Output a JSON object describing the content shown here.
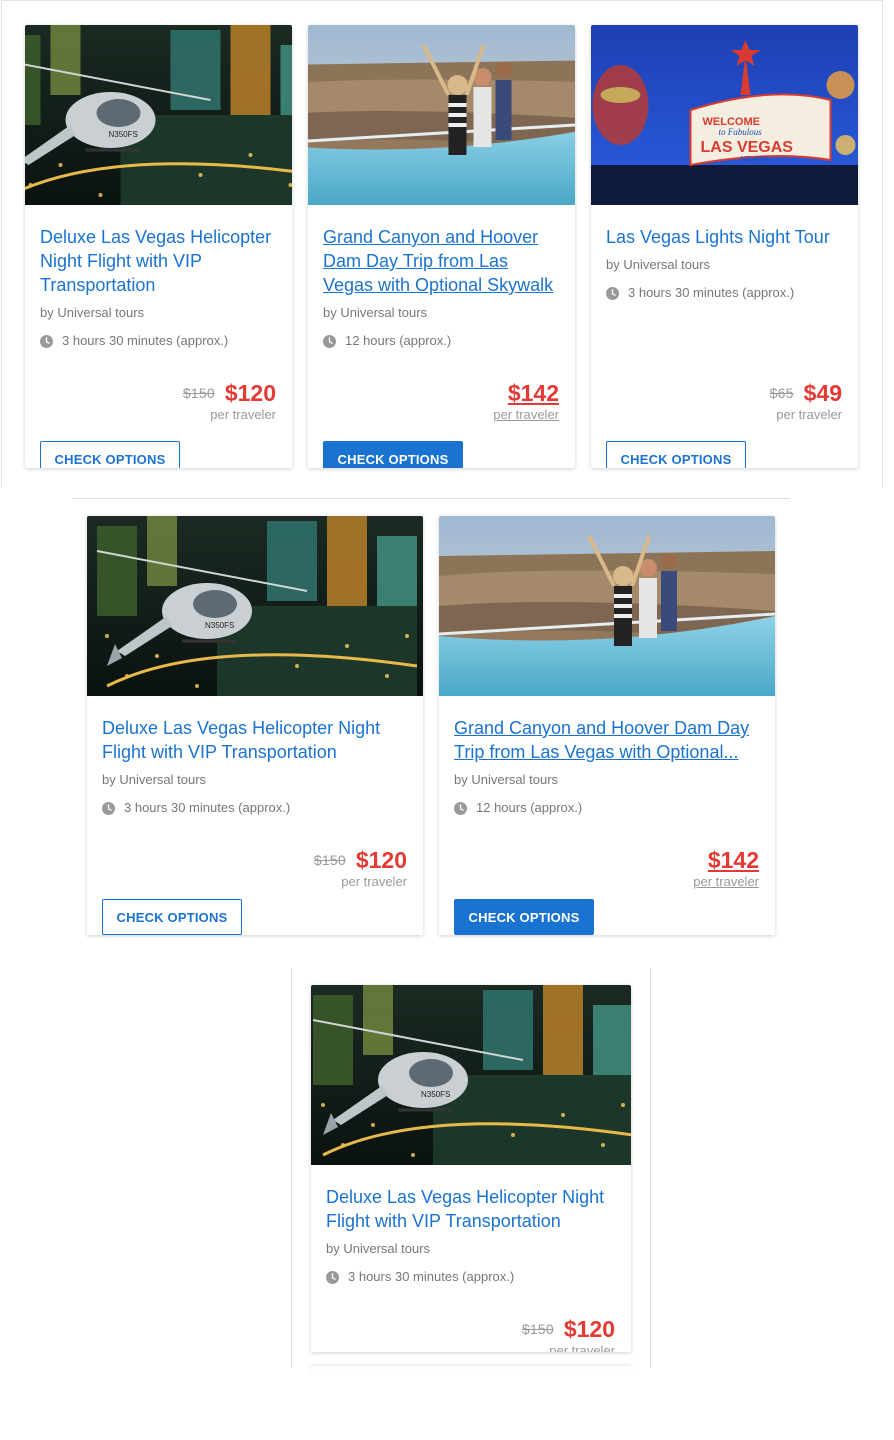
{
  "colors": {
    "accent": "#1a73d0",
    "price": "#e53935",
    "muted": "#777777"
  },
  "common": {
    "per_traveler": "per traveler",
    "check_options": "CHECK OPTIONS",
    "clock_icon": "clock-icon"
  },
  "section1": {
    "cards": [
      {
        "title": "Deluxe Las Vegas Helicopter Night Flight with VIP Transportation",
        "vendor": "by Universal tours",
        "duration": "3 hours 30 minutes (approx.)",
        "old_price": "$150",
        "price": "$120",
        "image": "helicopter-night-image"
      },
      {
        "title": "Grand Canyon and Hoover Dam Day Trip from Las Vegas with Optional Skywalk",
        "vendor": "by Universal tours",
        "duration": "12 hours (approx.)",
        "old_price": "",
        "price": "$142",
        "image": "grand-canyon-skywalk-image"
      },
      {
        "title": "Las Vegas Lights Night Tour",
        "vendor": "by Universal tours",
        "duration": "3 hours 30 minutes (approx.)",
        "old_price": "$65",
        "price": "$49",
        "image": "las-vegas-sign-image"
      }
    ]
  },
  "section2": {
    "cards": [
      {
        "title": "Deluxe Las Vegas Helicopter Night Flight with VIP Transportation",
        "vendor": "by Universal tours",
        "duration": "3 hours 30 minutes (approx.)",
        "old_price": "$150",
        "price": "$120"
      },
      {
        "title": "Grand Canyon and Hoover Dam Day Trip from Las Vegas with Optional...",
        "vendor": "by Universal tours",
        "duration": "12 hours (approx.)",
        "price": "$142"
      }
    ]
  },
  "section3": {
    "cards": [
      {
        "title": "Deluxe Las Vegas Helicopter Night Flight with VIP Transportation",
        "vendor": "by Universal tours",
        "duration": "3 hours 30 minutes (approx.)",
        "old_price": "$150",
        "price": "$120"
      }
    ]
  }
}
